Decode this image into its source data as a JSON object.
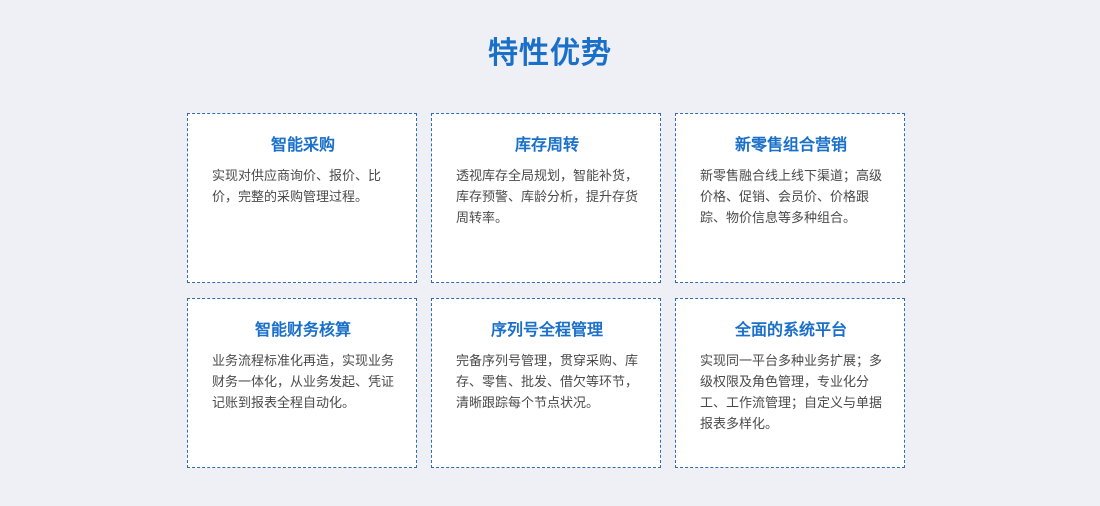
{
  "section": {
    "title": "特性优势"
  },
  "features": [
    {
      "title": "智能采购",
      "description": "实现对供应商询价、报价、比价，完整的采购管理过程。"
    },
    {
      "title": "库存周转",
      "description": "透视库存全局规划，智能补货，库存预警、库龄分析，提升存货周转率。"
    },
    {
      "title": "新零售组合营销",
      "description": "新零售融合线上线下渠道；高级价格、促销、会员价、价格跟踪、物价信息等多种组合。"
    },
    {
      "title": "智能财务核算",
      "description": "业务流程标准化再造，实现业务财务一体化，从业务发起、凭证记账到报表全程自动化。"
    },
    {
      "title": "序列号全程管理",
      "description": "完备序列号管理，贯穿采购、库存、零售、批发、借欠等环节，清晰跟踪每个节点状况。"
    },
    {
      "title": "全面的系统平台",
      "description": "实现同一平台多种业务扩展；多级权限及角色管理，专业化分工、工作流管理；自定义与单据报表多样化。"
    }
  ],
  "colors": {
    "accent": "#1a6fc9",
    "border": "#2f6bb8",
    "background": "#eef0f5",
    "card_background": "#ffffff",
    "text": "#4a4a4a"
  }
}
